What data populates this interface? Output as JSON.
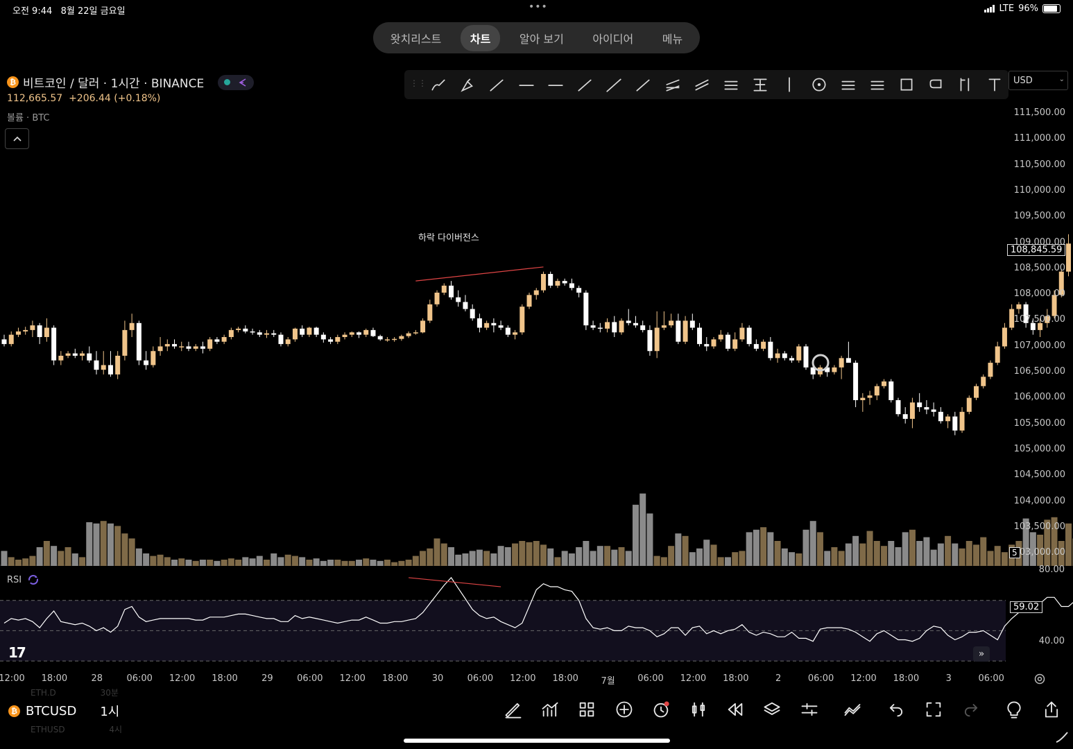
{
  "status": {
    "time": "오전 9:44",
    "date": "8월 22일 금요일",
    "network": "LTE",
    "battery": "96%",
    "battery_level": 0.96
  },
  "tabs": [
    {
      "label": "왓치리스트",
      "active": false
    },
    {
      "label": "차트",
      "active": true
    },
    {
      "label": "알아 보기",
      "active": false
    },
    {
      "label": "아이디어",
      "active": false
    },
    {
      "label": "메뉴",
      "active": false
    }
  ],
  "symbol": {
    "coin_glyph": "₿",
    "title": "비트코인 / 달러 · 1시간 · BINANCE",
    "price": "112,665.57",
    "change": "+206.44 (+0.18%)",
    "volume_label": "볼륨 · BTC",
    "up_color": "#f0c48a",
    "down_color": "#ffffff"
  },
  "toolbar": {
    "icons": [
      "brush-icon",
      "highlighter-icon",
      "trend-line-icon",
      "horizontal-line-icon",
      "horizontal-ray-icon",
      "ray-icon",
      "extended-line-icon",
      "info-line-icon",
      "parallel-channel-icon",
      "regression-trend-icon",
      "pitchfork-icon",
      "fib-retracement-icon",
      "vertical-line-icon",
      "circle-icon",
      "gann-box-icon",
      "fib-channel-icon",
      "rectangle-icon",
      "callout-icon",
      "long-position-icon",
      "text-tool-icon"
    ],
    "currency": "USD"
  },
  "price_axis": {
    "ticks": [
      "111,500.00",
      "111,000.00",
      "110,500.00",
      "110,000.00",
      "109,500.00",
      "109,000.00",
      "108,500.00",
      "108,000.00",
      "107,500.00",
      "107,000.00",
      "106,500.00",
      "106,000.00",
      "105,500.00",
      "105,000.00",
      "104,500.00",
      "104,000.00",
      "103,500.00",
      "103,000.00"
    ],
    "current_price_tag": "108,845.59",
    "volume_scale_badge": "5"
  },
  "annotation": {
    "text": "하락 다이버전스"
  },
  "rsi": {
    "label": "RSI",
    "value_tag": "59.02",
    "ticks": [
      "80.00",
      "40.00"
    ]
  },
  "time_axis": [
    "12:00",
    "18:00",
    "28",
    "06:00",
    "12:00",
    "18:00",
    "29",
    "06:00",
    "12:00",
    "18:00",
    "30",
    "06:00",
    "12:00",
    "18:00",
    "7월",
    "06:00",
    "12:00",
    "18:00",
    "2",
    "06:00",
    "12:00",
    "18:00",
    "3",
    "06:00"
  ],
  "bottom_bar": {
    "symbol": "BTCUSD",
    "interval": "1시",
    "ghost_symbol_above": "ETH.D",
    "ghost_interval_above": "30분",
    "ghost_symbol_below": "ETHUSD",
    "ghost_interval_below": "4시",
    "icons": [
      "drawing-pen-icon",
      "indicators-icon",
      "layouts-icon",
      "add-icon",
      "alert-icon",
      "chart-type-icon",
      "replay-icon",
      "layers-icon",
      "settings-sliders-icon",
      "compare-icon",
      "undo-icon",
      "fullscreen-icon",
      "redo-icon",
      "ideas-bulb-icon",
      "share-icon"
    ]
  },
  "chart_data": {
    "type": "candlestick",
    "symbol": "BTCUSD",
    "interval": "1h",
    "y_range": [
      102700,
      111900
    ],
    "rsi_range": [
      20,
      90
    ],
    "candles": [
      [
        107250,
        107350,
        107100,
        107150
      ],
      [
        107150,
        107420,
        107100,
        107350
      ],
      [
        107350,
        107500,
        107300,
        107420
      ],
      [
        107420,
        107520,
        107350,
        107450
      ],
      [
        107450,
        107650,
        107300,
        107550
      ],
      [
        107550,
        107600,
        107150,
        107300
      ],
      [
        107300,
        107700,
        107200,
        107500
      ],
      [
        107500,
        107550,
        106700,
        106800
      ],
      [
        106800,
        107000,
        106700,
        106900
      ],
      [
        106900,
        107000,
        106850,
        106950
      ],
      [
        106950,
        107050,
        106850,
        106900
      ],
      [
        106900,
        107000,
        106800,
        106950
      ],
      [
        106950,
        107100,
        106750,
        106800
      ],
      [
        106800,
        107000,
        106500,
        106600
      ],
      [
        106600,
        107000,
        106500,
        106700
      ],
      [
        106700,
        107000,
        106450,
        106500
      ],
      [
        106500,
        107000,
        106400,
        106900
      ],
      [
        106900,
        107650,
        106800,
        107450
      ],
      [
        107450,
        107800,
        107300,
        107600
      ],
      [
        107600,
        107650,
        106700,
        106800
      ],
      [
        106800,
        107000,
        106600,
        106700
      ],
      [
        106700,
        107100,
        106650,
        107000
      ],
      [
        107000,
        107300,
        106900,
        107100
      ],
      [
        107100,
        107250,
        107000,
        107150
      ],
      [
        107150,
        107250,
        107050,
        107100
      ],
      [
        107100,
        107200,
        107000,
        107100
      ],
      [
        107100,
        107200,
        107000,
        107050
      ],
      [
        107050,
        107150,
        107000,
        107100
      ],
      [
        107100,
        107200,
        106950,
        107050
      ],
      [
        107050,
        107300,
        107000,
        107250
      ],
      [
        107250,
        107300,
        107150,
        107200
      ],
      [
        107200,
        107350,
        107150,
        107300
      ],
      [
        107300,
        107500,
        107250,
        107450
      ],
      [
        107450,
        107520,
        107400,
        107480
      ],
      [
        107480,
        107550,
        107380,
        107420
      ],
      [
        107420,
        107480,
        107350,
        107400
      ],
      [
        107400,
        107450,
        107300,
        107350
      ],
      [
        107350,
        107450,
        107280,
        107380
      ],
      [
        107380,
        107450,
        107300,
        107350
      ],
      [
        107350,
        107400,
        107100,
        107150
      ],
      [
        107150,
        107300,
        107100,
        107250
      ],
      [
        107250,
        107500,
        107200,
        107480
      ],
      [
        107480,
        107550,
        107300,
        107350
      ],
      [
        107350,
        107520,
        107300,
        107500
      ],
      [
        107500,
        107520,
        107300,
        107350
      ],
      [
        107350,
        107400,
        107180,
        107250
      ],
      [
        107250,
        107300,
        107150,
        107200
      ],
      [
        107200,
        107350,
        107150,
        107300
      ],
      [
        107300,
        107400,
        107250,
        107350
      ],
      [
        107350,
        107420,
        107300,
        107400
      ],
      [
        107400,
        107420,
        107280,
        107350
      ],
      [
        107350,
        107480,
        107300,
        107450
      ],
      [
        107450,
        107500,
        107300,
        107320
      ],
      [
        107320,
        107350,
        107220,
        107250
      ],
      [
        107250,
        107300,
        107200,
        107250
      ],
      [
        107250,
        107300,
        107200,
        107260
      ],
      [
        107260,
        107350,
        107220,
        107320
      ],
      [
        107320,
        107420,
        107280,
        107380
      ],
      [
        107380,
        107450,
        107350,
        107400
      ],
      [
        107400,
        107700,
        107380,
        107650
      ],
      [
        107650,
        108100,
        107600,
        108000
      ],
      [
        108000,
        108300,
        107950,
        108250
      ],
      [
        108250,
        108450,
        108200,
        108400
      ],
      [
        108400,
        108500,
        108100,
        108150
      ],
      [
        108150,
        108300,
        107950,
        108050
      ],
      [
        108050,
        108200,
        107850,
        107900
      ],
      [
        107900,
        108000,
        107650,
        107700
      ],
      [
        107700,
        107800,
        107400,
        107500
      ],
      [
        107500,
        107650,
        107450,
        107600
      ],
      [
        107600,
        107700,
        107400,
        107550
      ],
      [
        107550,
        107650,
        107450,
        107500
      ],
      [
        107500,
        107550,
        107300,
        107350
      ],
      [
        107350,
        107450,
        107250,
        107400
      ],
      [
        107400,
        108000,
        107350,
        107950
      ],
      [
        107950,
        108250,
        107900,
        108200
      ],
      [
        108200,
        108350,
        108100,
        108300
      ],
      [
        108300,
        108700,
        108250,
        108650
      ],
      [
        108650,
        108700,
        108350,
        108400
      ],
      [
        108400,
        108550,
        108350,
        108500
      ],
      [
        108500,
        108550,
        108400,
        108450
      ],
      [
        108450,
        108550,
        108300,
        108350
      ],
      [
        108350,
        108400,
        108150,
        108250
      ],
      [
        108250,
        108300,
        107450,
        107550
      ],
      [
        107550,
        107650,
        107450,
        107500
      ],
      [
        107500,
        107600,
        107400,
        107480
      ],
      [
        107480,
        107700,
        107400,
        107620
      ],
      [
        107620,
        107750,
        107300,
        107400
      ],
      [
        107400,
        107700,
        107350,
        107650
      ],
      [
        107650,
        107900,
        107550,
        107600
      ],
      [
        107600,
        107750,
        107500,
        107550
      ],
      [
        107550,
        107650,
        107400,
        107450
      ],
      [
        107450,
        107550,
        106900,
        107000
      ],
      [
        107000,
        107850,
        106850,
        107500
      ],
      [
        107500,
        107850,
        107450,
        107550
      ],
      [
        107550,
        107800,
        107500,
        107650
      ],
      [
        107650,
        107800,
        107150,
        107200
      ],
      [
        107200,
        107750,
        107150,
        107650
      ],
      [
        107650,
        107800,
        107450,
        107500
      ],
      [
        107500,
        107600,
        107100,
        107150
      ],
      [
        107150,
        107300,
        107000,
        107100
      ],
      [
        107100,
        107300,
        107050,
        107250
      ],
      [
        107250,
        107450,
        107200,
        107350
      ],
      [
        107350,
        107400,
        107000,
        107050
      ],
      [
        107050,
        107400,
        107000,
        107250
      ],
      [
        107250,
        107600,
        107200,
        107500
      ],
      [
        107500,
        107550,
        107100,
        107150
      ],
      [
        107150,
        107250,
        107000,
        107050
      ],
      [
        107050,
        107250,
        107000,
        107200
      ],
      [
        107200,
        107300,
        106800,
        106850
      ],
      [
        106850,
        107050,
        106750,
        106950
      ],
      [
        106950,
        107000,
        106800,
        106850
      ],
      [
        106850,
        106900,
        106750,
        106800
      ],
      [
        106800,
        107150,
        106750,
        107100
      ],
      [
        107100,
        107150,
        106600,
        106650
      ],
      [
        106650,
        106750,
        106400,
        106500
      ],
      [
        106500,
        106700,
        106450,
        106650
      ],
      [
        106650,
        106700,
        106450,
        106550
      ],
      [
        106550,
        106700,
        106500,
        106650
      ],
      [
        106650,
        106900,
        106400,
        106850
      ],
      [
        106850,
        107200,
        106800,
        106750
      ],
      [
        106750,
        106800,
        105800,
        105950
      ],
      [
        105950,
        106100,
        105700,
        106000
      ],
      [
        106000,
        106150,
        105850,
        106050
      ],
      [
        106050,
        106300,
        105950,
        106250
      ],
      [
        106250,
        106400,
        106200,
        106350
      ],
      [
        106350,
        106400,
        105900,
        105950
      ],
      [
        105950,
        106000,
        105600,
        105650
      ],
      [
        105650,
        105800,
        105450,
        105550
      ],
      [
        105550,
        106000,
        105350,
        105900
      ],
      [
        105900,
        106100,
        105700,
        105800
      ],
      [
        105800,
        105950,
        105650,
        105750
      ],
      [
        105750,
        105900,
        105600,
        105700
      ],
      [
        105700,
        105800,
        105450,
        105500
      ],
      [
        105500,
        105650,
        105350,
        105600
      ],
      [
        105600,
        105700,
        105200,
        105300
      ],
      [
        105300,
        105800,
        105250,
        105700
      ],
      [
        105700,
        106050,
        105650,
        106000
      ],
      [
        106000,
        106300,
        105950,
        106250
      ],
      [
        106250,
        106500,
        106200,
        106450
      ],
      [
        106450,
        106800,
        106400,
        106750
      ],
      [
        106750,
        107200,
        106700,
        107100
      ],
      [
        107100,
        107600,
        107050,
        107500
      ],
      [
        107500,
        108000,
        107450,
        107900
      ],
      [
        107900,
        108050,
        107800,
        108000
      ],
      [
        108000,
        108050,
        107500,
        107600
      ],
      [
        107600,
        107700,
        107350,
        107450
      ],
      [
        107450,
        107700,
        107300,
        107600
      ],
      [
        107600,
        107900,
        107500,
        107750
      ],
      [
        107750,
        108300,
        107700,
        108200
      ],
      [
        108200,
        108750,
        108150,
        108700
      ],
      [
        108700,
        109500,
        108600,
        109300
      ],
      [
        109300,
        109850,
        109200,
        109600
      ],
      [
        109600,
        109650,
        109200,
        109300
      ],
      [
        109300,
        109750,
        109250,
        109550
      ],
      [
        109550,
        109750,
        109000,
        109050
      ],
      [
        109050,
        109600,
        109000,
        109500
      ],
      [
        109500,
        109750,
        109450,
        109650
      ],
      [
        109650,
        109700,
        109100,
        109150
      ],
      [
        109150,
        109550,
        109100,
        109450
      ],
      [
        109450,
        109550,
        109000,
        109100
      ],
      [
        109100,
        109150,
        108800,
        108846
      ]
    ],
    "volume_fractions": [
      0.12,
      0.07,
      0.05,
      0.06,
      0.08,
      0.15,
      0.2,
      0.16,
      0.12,
      0.15,
      0.1,
      0.07,
      0.35,
      0.34,
      0.36,
      0.34,
      0.32,
      0.26,
      0.22,
      0.14,
      0.1,
      0.08,
      0.09,
      0.07,
      0.05,
      0.06,
      0.05,
      0.04,
      0.05,
      0.05,
      0.04,
      0.05,
      0.06,
      0.05,
      0.07,
      0.06,
      0.08,
      0.05,
      0.1,
      0.07,
      0.09,
      0.08,
      0.07,
      0.05,
      0.06,
      0.04,
      0.05,
      0.05,
      0.04,
      0.04,
      0.05,
      0.06,
      0.05,
      0.04,
      0.05,
      0.03,
      0.04,
      0.05,
      0.08,
      0.12,
      0.14,
      0.22,
      0.18,
      0.15,
      0.09,
      0.1,
      0.12,
      0.13,
      0.12,
      0.1,
      0.16,
      0.15,
      0.18,
      0.2,
      0.19,
      0.2,
      0.17,
      0.14,
      0.07,
      0.12,
      0.1,
      0.15,
      0.2,
      0.12,
      0.16,
      0.16,
      0.13,
      0.15,
      0.12,
      0.49,
      0.58,
      0.42,
      0.08,
      0.07,
      0.16,
      0.26,
      0.24,
      0.11,
      0.14,
      0.21,
      0.17,
      0.07,
      0.07,
      0.11,
      0.12,
      0.27,
      0.29,
      0.31,
      0.27,
      0.2,
      0.14,
      0.11,
      0.1,
      0.29,
      0.36,
      0.27,
      0.12,
      0.15,
      0.12,
      0.18,
      0.24,
      0.18,
      0.28,
      0.2,
      0.16,
      0.2,
      0.15,
      0.27,
      0.29,
      0.2,
      0.23,
      0.13,
      0.18,
      0.24,
      0.18,
      0.14,
      0.2,
      0.17,
      0.23,
      0.12,
      0.16,
      0.11,
      0.17,
      0.2,
      0.38,
      0.27,
      0.25,
      0.37,
      0.39,
      0.2,
      0.34,
      0.22,
      0.2,
      0.16,
      0.2,
      0.25,
      0.52,
      0.3,
      0.4,
      0.55,
      0.6,
      0.59,
      0.72,
      0.49,
      0.39,
      0.29,
      0.28,
      0.3,
      0.26,
      0.14,
      0.1,
      0.08,
      0.16
    ],
    "rsi": [
      55,
      58,
      57,
      58,
      56,
      52,
      58,
      63,
      56,
      55,
      54,
      55,
      53,
      50,
      52,
      49,
      53,
      64,
      66,
      59,
      56,
      57,
      58,
      58,
      58,
      58,
      58,
      57,
      57,
      59,
      59,
      59,
      60,
      61,
      61,
      60,
      59,
      58,
      58,
      56,
      56,
      60,
      58,
      59,
      58,
      57,
      56,
      55,
      56,
      57,
      57,
      59,
      57,
      55,
      55,
      56,
      56,
      57,
      58,
      62,
      68,
      74,
      80,
      85,
      78,
      71,
      64,
      60,
      58,
      59,
      56,
      54,
      52,
      55,
      66,
      77,
      81,
      79,
      79,
      77,
      76,
      70,
      58,
      52,
      51,
      52,
      50,
      50,
      53,
      52,
      52,
      50,
      46,
      48,
      52,
      52,
      47,
      52,
      53,
      48,
      50,
      48,
      50,
      51,
      54,
      49,
      47,
      49,
      48,
      46,
      46,
      49,
      45,
      45,
      43,
      51,
      52,
      52,
      52,
      51,
      49,
      46,
      43,
      48,
      50,
      47,
      44,
      44,
      43,
      45,
      50,
      53,
      52,
      47,
      44,
      46,
      49,
      49,
      50,
      47,
      44,
      53,
      58,
      62,
      66,
      66,
      68,
      72,
      72,
      66,
      66,
      70,
      74,
      78,
      83,
      80,
      76,
      80,
      75,
      72,
      67,
      67
    ]
  }
}
